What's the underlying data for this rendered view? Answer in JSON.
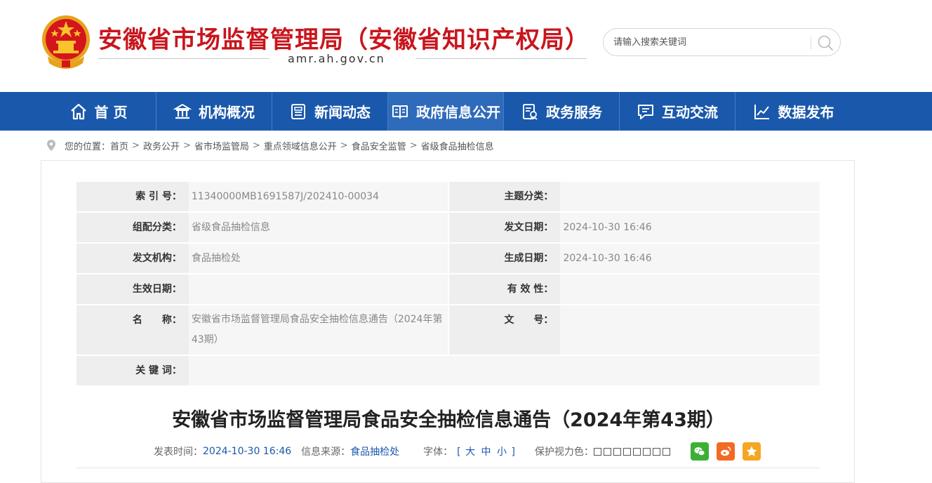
{
  "header": {
    "title": "安徽省市场监督管理局（安徽省知识产权局）",
    "domain": "amr.ah.gov.cn",
    "search_placeholder": "请输入搜索关键词"
  },
  "nav": [
    {
      "label": "首 页",
      "icon": "home-icon"
    },
    {
      "label": "机构概况",
      "icon": "institution-icon"
    },
    {
      "label": "新闻动态",
      "icon": "news-icon"
    },
    {
      "label": "政府信息公开",
      "icon": "open-book-icon"
    },
    {
      "label": "政务服务",
      "icon": "service-icon"
    },
    {
      "label": "互动交流",
      "icon": "chat-icon"
    },
    {
      "label": "数据发布",
      "icon": "chart-icon"
    }
  ],
  "breadcrumb": {
    "prefix": "您的位置：",
    "items": [
      "首页",
      "政务公开",
      "省市场监管局",
      "重点领域信息公开",
      "食品安全监管",
      "省级食品抽检信息"
    ]
  },
  "meta": {
    "index_label": "索 引 号：",
    "index_value": "11340000MB1691587J/202410-00034",
    "topic_label": "主题分类：",
    "topic_value": "",
    "group_label": "组配分类：",
    "group_value": "省级食品抽检信息",
    "issue_date_label": "发文日期：",
    "issue_date_value": "2024-10-30 16:46",
    "org_label": "发文机构：",
    "org_value": "食品抽检处",
    "gen_date_label": "生成日期：",
    "gen_date_value": "2024-10-30 16:46",
    "effective_label": "生效日期：",
    "effective_value": "",
    "validity_label": "有 效 性：",
    "validity_value": "",
    "name_label": "名　　称：",
    "name_value": "安徽省市场监督管理局食品安全抽检信息通告（2024年第43期）",
    "docno_label": "文　　号：",
    "docno_value": "",
    "keywords_label": "关 键 词：",
    "keywords_value": ""
  },
  "article": {
    "title": "安徽省市场监督管理局食品安全抽检信息通告（2024年第43期）",
    "publish_label": "发表时间：",
    "publish_value": "2024-10-30 16:46",
    "source_label": "信息来源：",
    "source_value": "食品抽检处",
    "fontsize_label": "字体：",
    "fontsize_open": "[",
    "fontsize_large": "大",
    "fontsize_medium": "中",
    "fontsize_small": "小",
    "fontsize_close": "]",
    "eye_label": "保护视力色：",
    "eye_colors": [
      "#ffffff",
      "#ffffff",
      "#ffffff",
      "#ffffff",
      "#ffffff",
      "#ffffff",
      "#ffffff",
      "#ffffff"
    ],
    "share": [
      {
        "icon": "wechat-icon",
        "color": "#3cb034"
      },
      {
        "icon": "weibo-icon",
        "color": "#f36a22"
      },
      {
        "icon": "favorite-star-icon",
        "color": "#f5a623"
      }
    ]
  }
}
